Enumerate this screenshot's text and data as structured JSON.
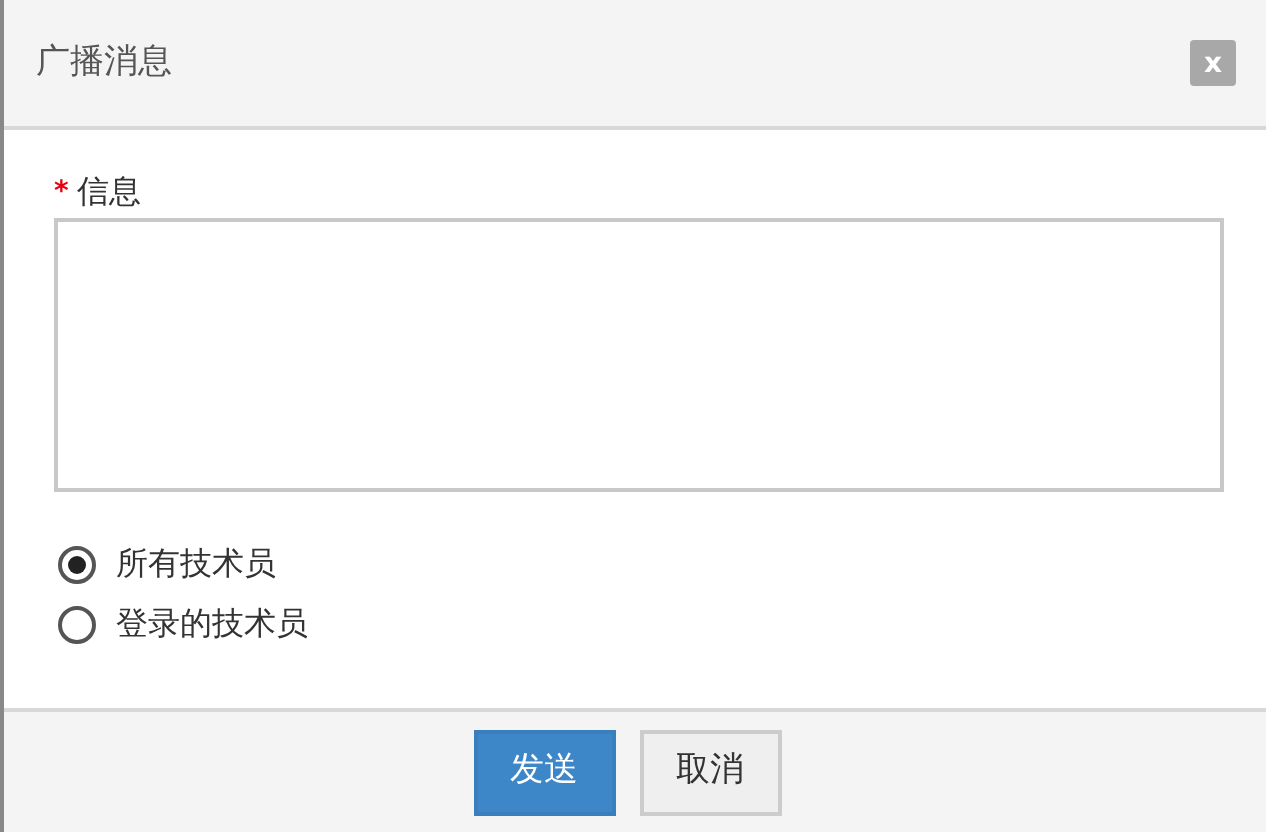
{
  "window": {
    "title": "广播消息",
    "close": "x"
  },
  "field": {
    "label": "信息",
    "required_mark": "*",
    "required": true
  },
  "recipients": [
    {
      "label": "所有技术员",
      "selected": true
    },
    {
      "label": "登录的技术员",
      "selected": false
    }
  ],
  "buttons": [
    {
      "label": "发送",
      "kind": "primary"
    },
    {
      "label": "取消",
      "kind": "secondary"
    }
  ]
}
